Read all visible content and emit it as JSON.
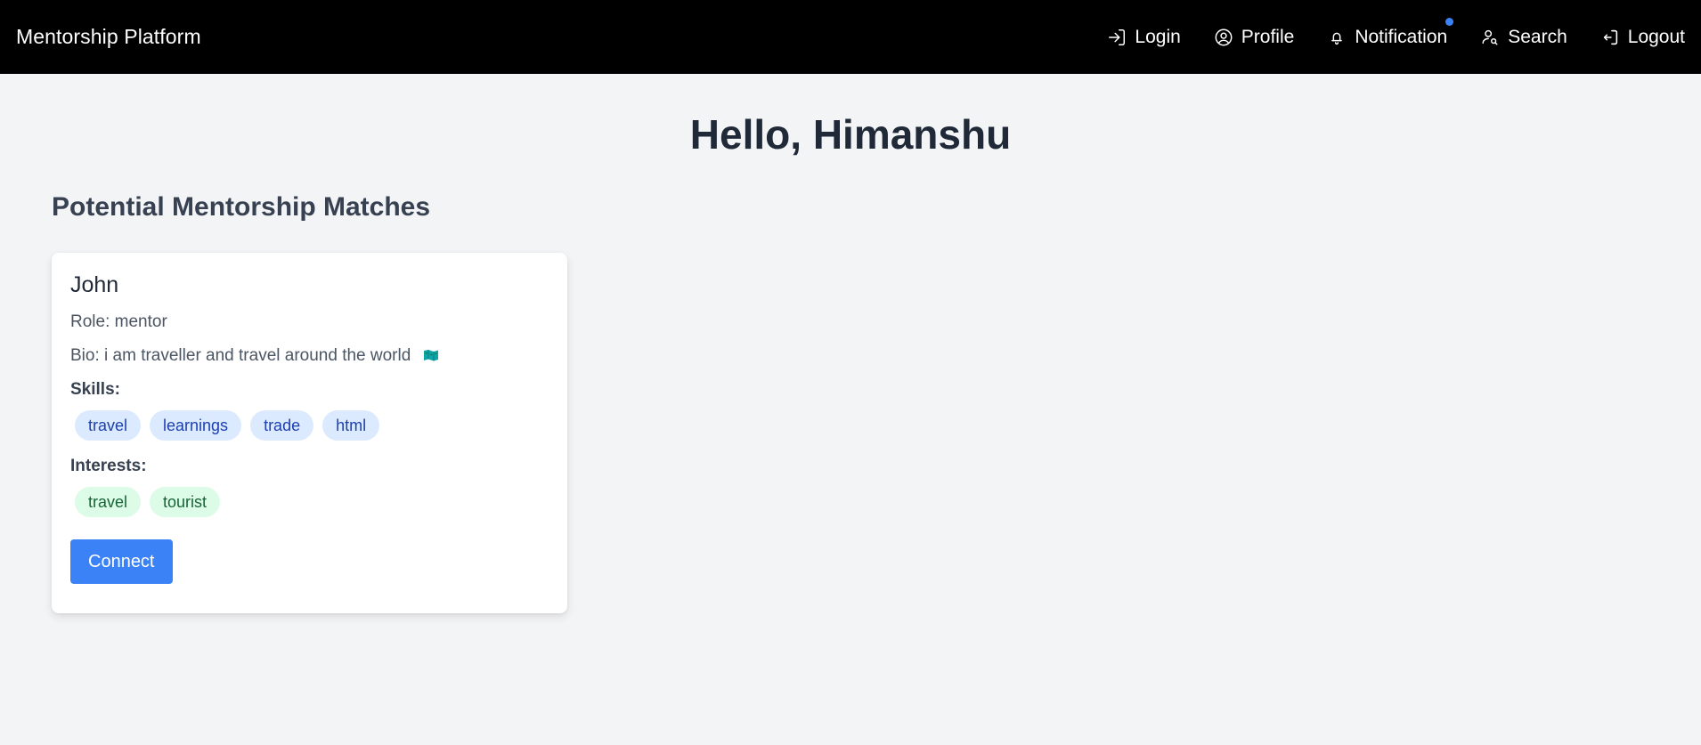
{
  "navbar": {
    "brand": "Mentorship Platform",
    "items": [
      {
        "label": "Login",
        "icon": "login-icon"
      },
      {
        "label": "Profile",
        "icon": "user-circle-icon"
      },
      {
        "label": "Notification",
        "icon": "bell-icon",
        "has_dot": true
      },
      {
        "label": "Search",
        "icon": "user-search-icon"
      },
      {
        "label": "Logout",
        "icon": "logout-icon"
      }
    ]
  },
  "main": {
    "greeting": "Hello, Himanshu",
    "section_title": "Potential Mentorship Matches"
  },
  "match_card": {
    "name": "John",
    "role": "Role: mentor",
    "bio": "Bio: i am traveller and travel around the world",
    "bio_emoji": "map-icon",
    "skills_label": "Skills:",
    "skills": [
      "travel",
      "learnings",
      "trade",
      "html"
    ],
    "interests_label": "Interests:",
    "interests": [
      "travel",
      "tourist"
    ],
    "connect_label": "Connect"
  },
  "colors": {
    "navbar_bg": "#000000",
    "page_bg": "#f3f4f6",
    "accent": "#3b82f6",
    "skill_tag_bg": "#dbeafe",
    "skill_tag_text": "#1e40af",
    "interest_tag_bg": "#dcfce7",
    "interest_tag_text": "#166534"
  }
}
